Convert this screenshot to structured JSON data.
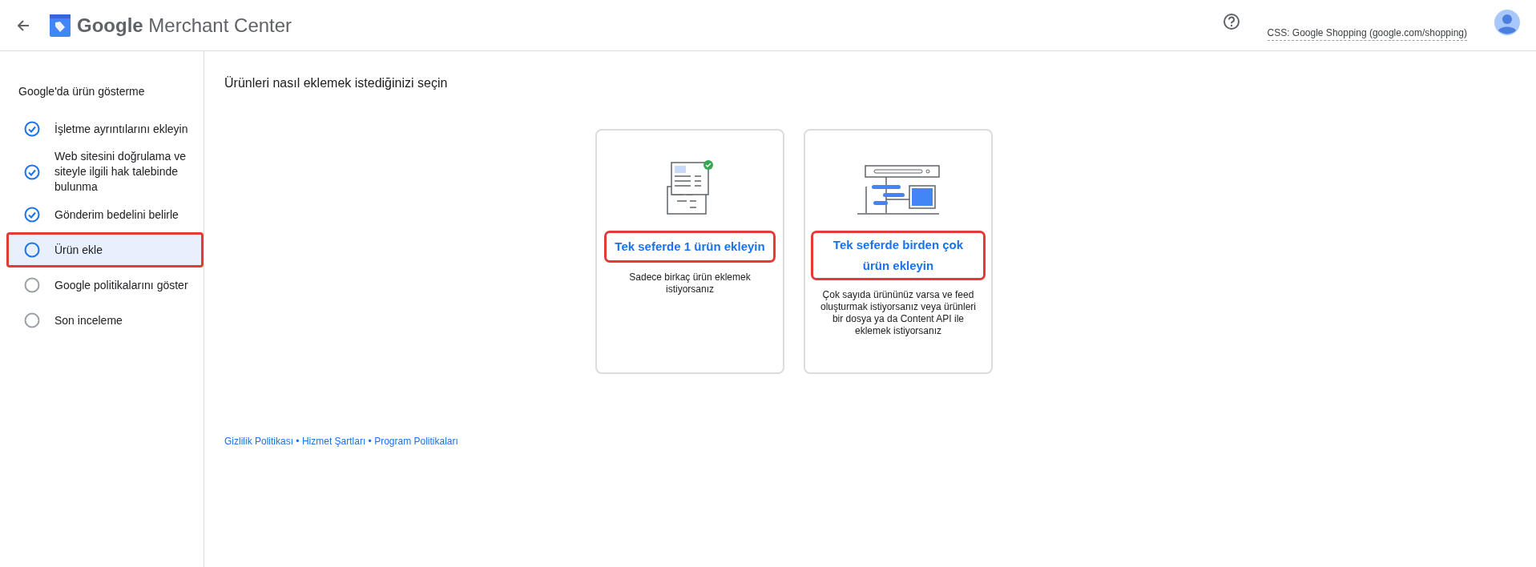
{
  "header": {
    "title_bold": "Google",
    "title_rest": "Merchant Center",
    "css_link": "CSS: Google Shopping (google.com/shopping)"
  },
  "sidebar": {
    "heading": "Google'da ürün gösterme",
    "steps": [
      {
        "label": "İşletme ayrıntılarını ekleyin",
        "done": true,
        "selected": false,
        "highlighted": false
      },
      {
        "label": "Web sitesini doğrulama ve siteyle ilgili hak talebinde bulunma",
        "done": true,
        "selected": false,
        "highlighted": false
      },
      {
        "label": "Gönderim bedelini belirle",
        "done": true,
        "selected": false,
        "highlighted": false
      },
      {
        "label": "Ürün ekle",
        "done": false,
        "selected": true,
        "highlighted": true
      },
      {
        "label": "Google politikalarını göster",
        "done": false,
        "selected": false,
        "highlighted": false
      },
      {
        "label": "Son inceleme",
        "done": false,
        "selected": false,
        "highlighted": false
      }
    ]
  },
  "main": {
    "title": "Ürünleri nasıl eklemek istediğinizi seçin",
    "options": [
      {
        "kind": "single",
        "label": "Tek seferde 1 ürün ekleyin",
        "description": "Sadece birkaç ürün eklemek istiyorsanız",
        "highlighted": true
      },
      {
        "kind": "multiple",
        "label": "Tek seferde birden çok ürün ekleyin",
        "description": "Çok sayıda ürününüz varsa ve feed oluşturmak istiyorsanız veya ürünleri bir dosya ya da Content API ile eklemek istiyorsanız",
        "highlighted": true
      }
    ]
  },
  "footer": {
    "links": [
      "Gizlilik Politikası",
      "Hizmet Şartları",
      "Program Politikaları"
    ],
    "separator": "•"
  }
}
